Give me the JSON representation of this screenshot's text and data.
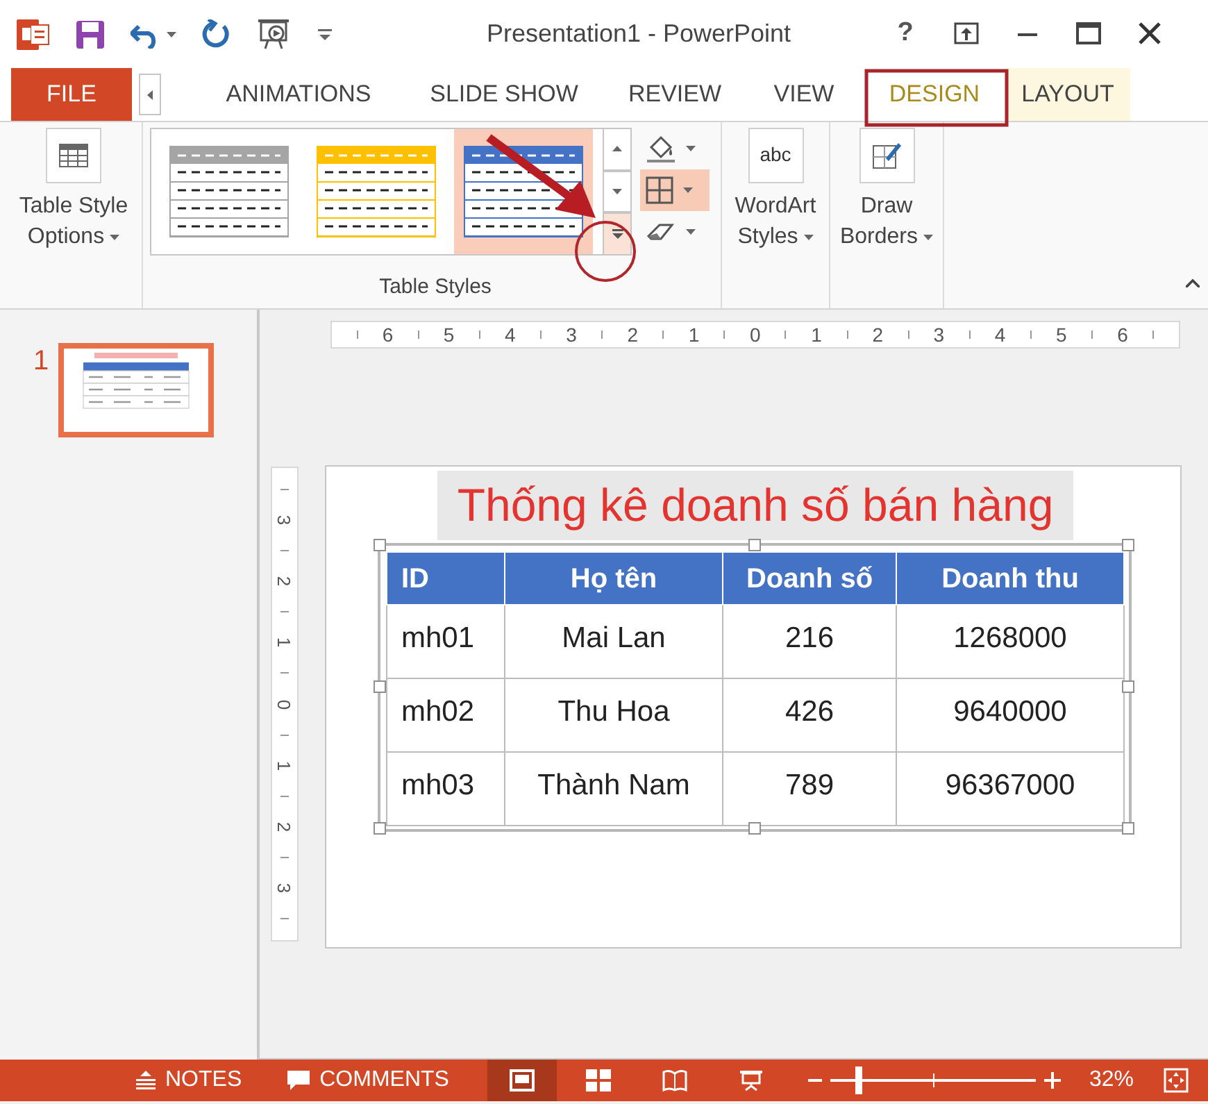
{
  "window": {
    "title": "Presentation1 - PowerPoint",
    "help": "?"
  },
  "tabs": [
    {
      "label": "FILE",
      "kind": "file",
      "selected": false
    },
    {
      "label": "ANIMATIONS",
      "kind": "normal",
      "selected": false
    },
    {
      "label": "SLIDE SHOW",
      "kind": "normal",
      "selected": false
    },
    {
      "label": "REVIEW",
      "kind": "normal",
      "selected": false
    },
    {
      "label": "VIEW",
      "kind": "normal",
      "selected": false
    },
    {
      "label": "DESIGN",
      "kind": "contextual",
      "selected": true
    },
    {
      "label": "LAYOUT",
      "kind": "contextual",
      "selected": false
    }
  ],
  "ribbon": {
    "table_style_options": "Table Style Options",
    "table_styles": {
      "label": "Table Styles",
      "gallery": [
        {
          "color": "#a5a5a5",
          "selected": false
        },
        {
          "color": "#ffc000",
          "selected": false
        },
        {
          "color": "#4472c4",
          "selected": true
        }
      ]
    },
    "wordart": {
      "icon_text": "abc",
      "label": "WordArt Styles"
    },
    "draw_borders": "Draw Borders"
  },
  "slides": [
    {
      "number": "1",
      "selected": true
    }
  ],
  "rulers": {
    "horizontal": [
      "6",
      "5",
      "4",
      "3",
      "2",
      "1",
      "0",
      "1",
      "2",
      "3",
      "4",
      "5",
      "6"
    ],
    "vertical": [
      "3",
      "2",
      "1",
      "0",
      "1",
      "2",
      "3"
    ]
  },
  "slide": {
    "title": "Thống kê doanh số bán hàng",
    "table": {
      "columns": [
        "ID",
        "Họ tên",
        "Doanh số",
        "Doanh thu"
      ],
      "rows": [
        [
          "mh01",
          "Mai Lan",
          "216",
          "1268000"
        ],
        [
          "mh02",
          "Thu Hoa",
          "426",
          "9640000"
        ],
        [
          "mh03",
          "Thành Nam",
          "789",
          "96367000"
        ]
      ]
    }
  },
  "status_bar": {
    "notes": "NOTES",
    "comments": "COMMENTS",
    "views": [
      {
        "kind": "normal",
        "selected": true
      },
      {
        "kind": "sorter",
        "selected": false
      },
      {
        "kind": "reading",
        "selected": false
      },
      {
        "kind": "show",
        "selected": false
      }
    ],
    "zoom": {
      "level": 0.13,
      "reading": "32%"
    }
  }
}
